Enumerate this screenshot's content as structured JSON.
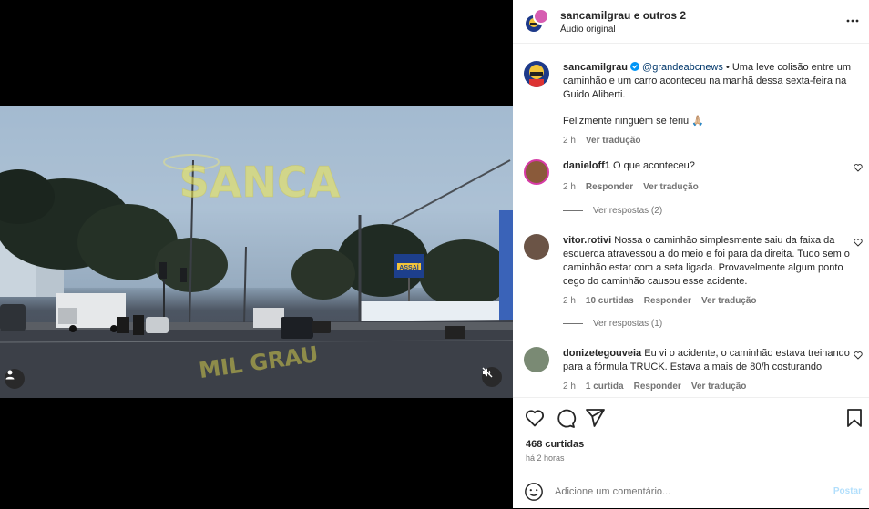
{
  "post": {
    "author_line": "sancamilgrau e outros 2",
    "audio": "Áudio original"
  },
  "video": {
    "watermark_top": "SANCA",
    "watermark_bottom": "MIL GRAU",
    "billboard": "ASSAÍ",
    "accent": "#f2e94e"
  },
  "caption": {
    "user": "sancamilgrau",
    "mention": "@grandeabcnews",
    "text": " • Uma leve colisão entre um caminhão e um carro aconteceu na manhã dessa sexta-feira na Guido Aliberti.",
    "text2": "Felizmente ninguém se feriu 🙏🏼",
    "time": "2 h",
    "translate": "Ver tradução"
  },
  "comments": [
    {
      "user": "danieloff1",
      "text": "O que aconteceu?",
      "time": "2 h",
      "reply": "Responder",
      "translate": "Ver tradução",
      "replies": "Ver respostas (2)"
    },
    {
      "user": "vitor.rotivi",
      "text": "Nossa o caminhão simplesmente saiu da faixa da esquerda atravessou a do meio e foi para da direita. Tudo sem o caminhão estar com a seta ligada. Provavelmente algum ponto cego do caminhão causou esse acidente.",
      "time": "2 h",
      "likes": "10 curtidas",
      "reply": "Responder",
      "translate": "Ver tradução",
      "replies": "Ver respostas (1)"
    },
    {
      "user": "donizetegouveia",
      "text": "Eu vi o acidente, o caminhão estava treinando para a fórmula TRUCK. Estava a mais de 80/h costurando",
      "time": "2 h",
      "likes": "1 curtida",
      "reply": "Responder",
      "translate": "Ver tradução"
    }
  ],
  "footer": {
    "likes": "468 curtidas",
    "time": "há 2 horas",
    "comment_placeholder": "Adicione um comentário...",
    "post_button": "Postar"
  },
  "colors": {
    "link": "#00376b",
    "muted": "#737373",
    "post_button": "#b2dffc",
    "verified": "#0095f6"
  },
  "icons": [
    "tag-user-icon",
    "mute-icon",
    "more-icon",
    "verified-icon",
    "heart-icon",
    "comment-icon",
    "share-icon",
    "save-icon",
    "emoji-icon"
  ]
}
